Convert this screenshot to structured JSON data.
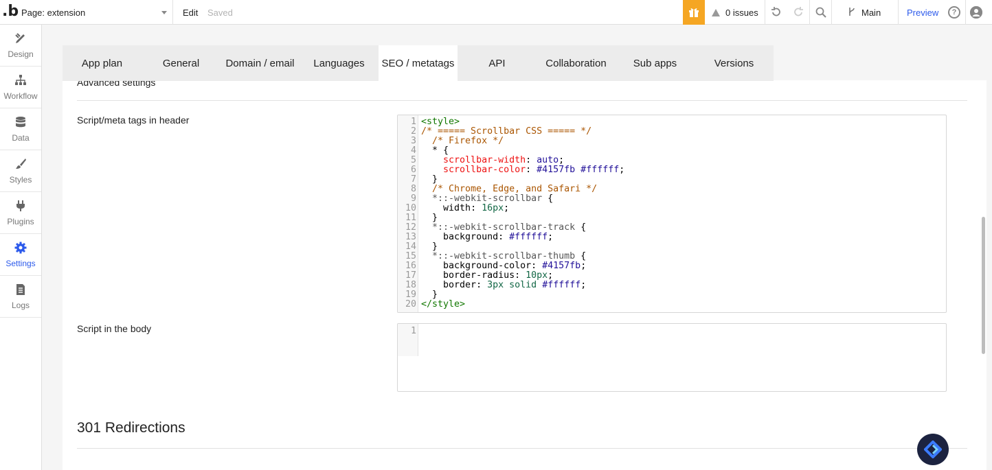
{
  "topbar": {
    "logo": ".b",
    "page_select": "Page: extension",
    "edit": "Edit",
    "saved": "Saved",
    "issues": "0 issues",
    "branch": "Main",
    "preview": "Preview"
  },
  "sidebar": {
    "items": [
      {
        "label": "Design",
        "icon": "design-icon"
      },
      {
        "label": "Workflow",
        "icon": "workflow-icon"
      },
      {
        "label": "Data",
        "icon": "database-icon"
      },
      {
        "label": "Styles",
        "icon": "brush-icon"
      },
      {
        "label": "Plugins",
        "icon": "plug-icon"
      },
      {
        "label": "Settings",
        "icon": "gear-icon"
      },
      {
        "label": "Logs",
        "icon": "document-icon"
      }
    ],
    "active": "Settings"
  },
  "tabs": [
    "App plan",
    "General",
    "Domain / email",
    "Languages",
    "SEO / metatags",
    "API",
    "Collaboration",
    "Sub apps",
    "Versions"
  ],
  "active_tab": "SEO / metatags",
  "section": {
    "advanced_settings": "Advanced settings",
    "header_label": "Script/meta tags in header",
    "body_label": "Script in the body",
    "redirections_title": "301 Redirections"
  },
  "header_code": {
    "line_numbers": [
      "1",
      "2",
      "3",
      "4",
      "5",
      "6",
      "7",
      "8",
      "9",
      "10",
      "11",
      "12",
      "13",
      "14",
      "15",
      "16",
      "17",
      "18",
      "19",
      "20"
    ],
    "l1": "<style>",
    "l2": "/* ===== Scrollbar CSS ===== */",
    "l3": "/* Firefox */",
    "l4": "* {",
    "l5_prop": "scrollbar-width",
    "l5_val": "auto",
    "l6_prop": "scrollbar-color",
    "l6_val": "#4157fb #ffffff",
    "l7": "}",
    "l8": "/* Chrome, Edge, and Safari */",
    "l9_sel": "*::-webkit-scrollbar",
    "l10_prop": "width",
    "l10_val": "16px",
    "l11": "}",
    "l12_sel": "*::-webkit-scrollbar-track",
    "l13_prop": "background",
    "l13_val": "#ffffff",
    "l14": "}",
    "l15_sel": "*::-webkit-scrollbar-thumb",
    "l16_prop": "background-color",
    "l16_val": "#4157fb",
    "l17_prop": "border-radius",
    "l17_val": "10px",
    "l18_prop": "border",
    "l18_num": "3px",
    "l18_kw": "solid",
    "l18_val": "#ffffff",
    "l19": "}",
    "l20": "</style>"
  },
  "body_code": {
    "line_numbers": [
      "1"
    ]
  },
  "colors": {
    "accent": "#2c5aeb",
    "gift": "#f5a623"
  }
}
